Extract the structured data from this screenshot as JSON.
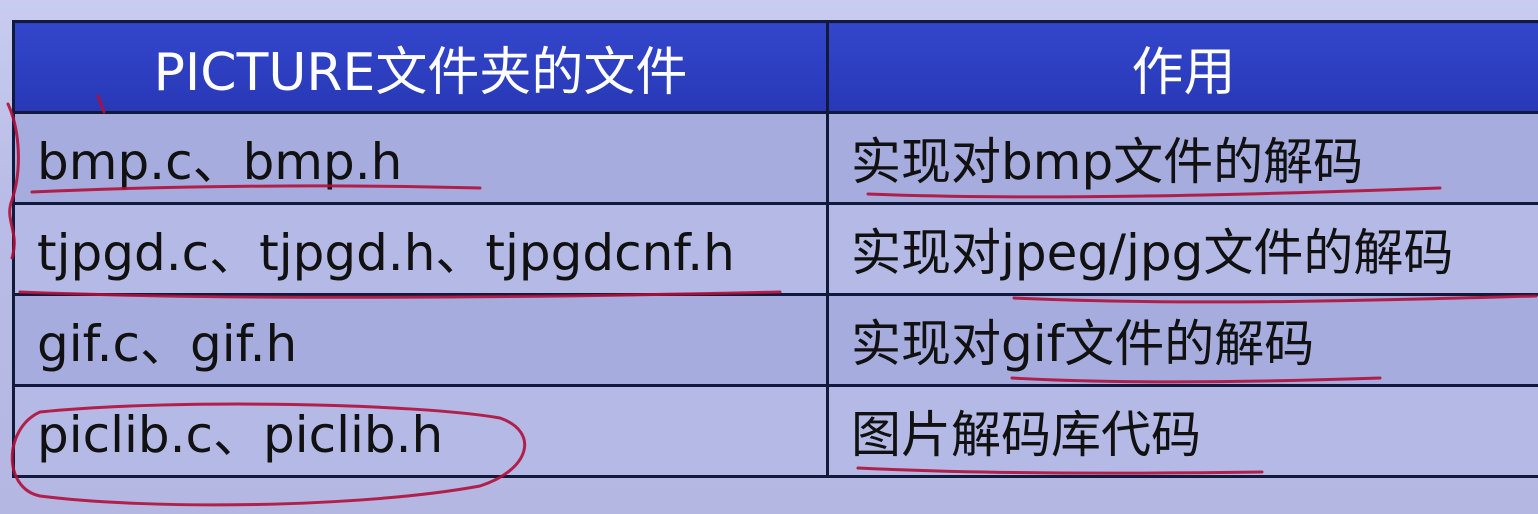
{
  "table": {
    "headers": [
      "PICTURE文件夹的文件",
      "作用"
    ],
    "rows": [
      {
        "files": "bmp.c、bmp.h",
        "purpose": "实现对bmp文件的解码"
      },
      {
        "files": "tjpgd.c、tjpgd.h、tjpgdcnf.h",
        "purpose": "实现对jpeg/jpg文件的解码"
      },
      {
        "files": "gif.c、gif.h",
        "purpose": "实现对gif文件的解码"
      },
      {
        "files": "piclib.c、piclib.h",
        "purpose": "图片解码库代码"
      }
    ]
  },
  "colors": {
    "header_bg": "#2d3fc0",
    "header_text": "#ffffff",
    "row_bg": "#a9aee0",
    "border": "#111a3a",
    "annotation_ink": "#b0103a"
  }
}
